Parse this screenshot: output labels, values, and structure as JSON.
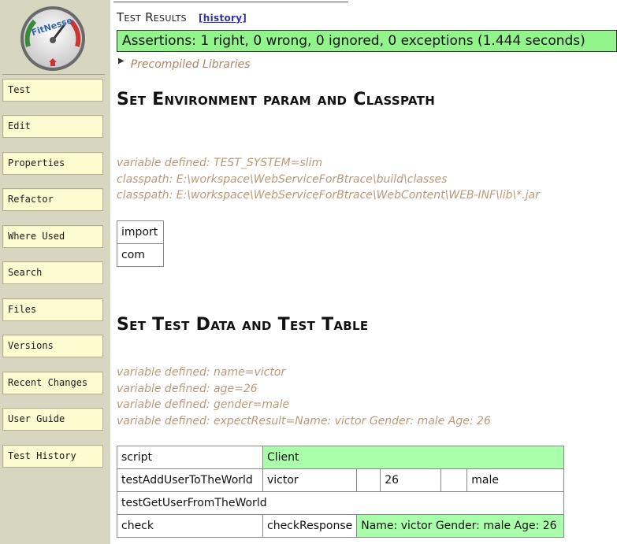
{
  "sidebar": {
    "logo_text": "FitNesse",
    "items": [
      {
        "label": "Test"
      },
      {
        "label": "Edit"
      },
      {
        "label": "Properties"
      },
      {
        "label": "Refactor"
      },
      {
        "label": "Where Used"
      },
      {
        "label": "Search"
      },
      {
        "label": "Files"
      },
      {
        "label": "Versions"
      },
      {
        "label": "Recent Changes"
      },
      {
        "label": "User Guide"
      },
      {
        "label": "Test History"
      }
    ]
  },
  "header": {
    "title": "Test Results",
    "history_link": "[history]"
  },
  "summary": {
    "text": "Assertions: 1 right, 0 wrong, 0 ignored, 0 exceptions (1.444 seconds)",
    "color": "#92f58c"
  },
  "collapsible": {
    "label": "Precompiled Libraries"
  },
  "section1": {
    "heading": "Set Environment param and Classpath",
    "lines": [
      "variable defined: TEST_SYSTEM=slim",
      "classpath: E:\\workspace\\WebServiceForBtrace\\build\\classes",
      "classpath: E:\\workspace\\WebServiceForBtrace\\WebContent\\WEB-INF\\lib\\*.jar"
    ],
    "import_table": [
      "import",
      "com"
    ]
  },
  "section2": {
    "heading": "Set Test Data and Test Table",
    "lines": [
      "variable defined: name=victor",
      "variable defined: age=26",
      "variable defined: gender=male",
      "variable defined: expectResult=Name: victor Gender: male Age: 26"
    ],
    "script_table": {
      "row1": [
        "script",
        "Client"
      ],
      "row2": [
        "testAddUserToTheWorld",
        "victor",
        "",
        "26",
        "",
        "male"
      ],
      "row3": [
        "testGetUserFromTheWorld"
      ],
      "row4": [
        "check",
        "checkResponse",
        "Name: victor Gender: male Age: 26"
      ]
    }
  }
}
